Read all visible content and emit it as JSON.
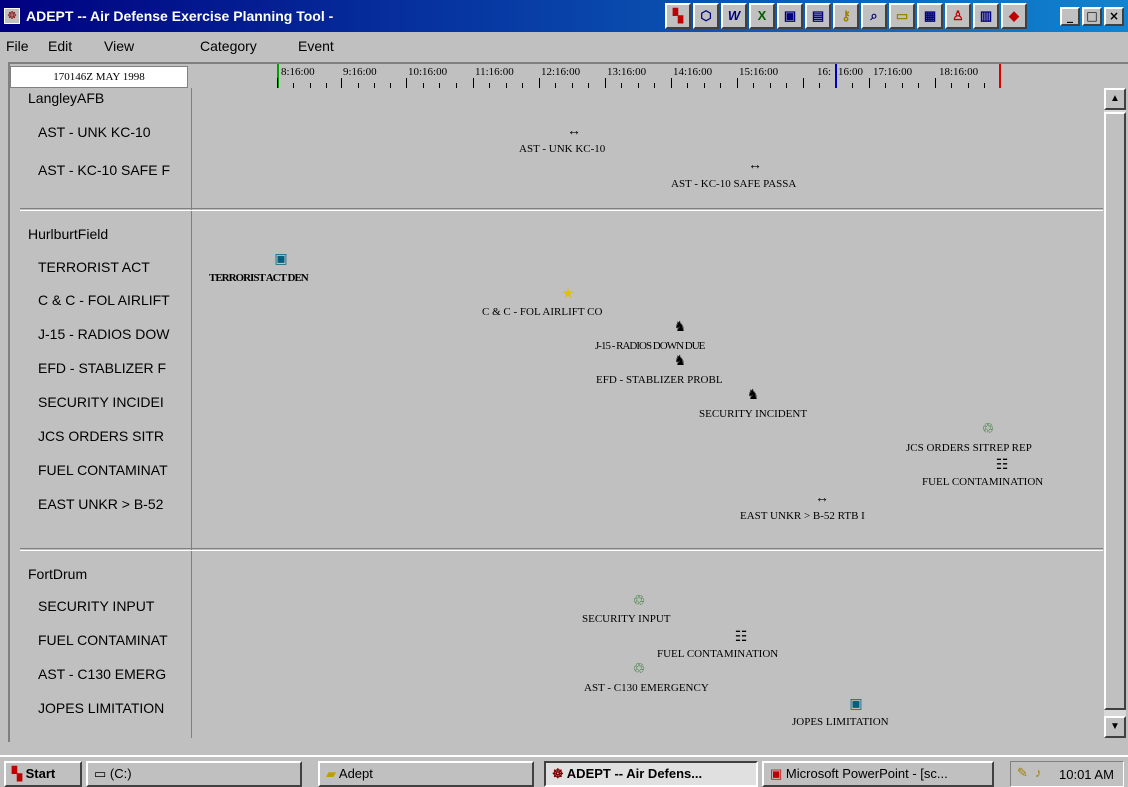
{
  "window": {
    "title": "ADEPT -- Air Defense Exercise Planning Tool -",
    "controls": {
      "minimize": "_",
      "maximize": "□",
      "close": "×"
    }
  },
  "toolbar_icons": [
    "palette-icon",
    "cube-icon",
    "word-icon",
    "excel-icon",
    "presentation-icon",
    "chart-icon",
    "key-icon",
    "magnifier-icon",
    "folder-icon",
    "terminal-icon",
    "people-icon",
    "monitor-icon",
    "diamond-icon"
  ],
  "menu": [
    "File",
    "Edit",
    "View",
    "Category",
    "Event"
  ],
  "timeline": {
    "date": "170146Z MAY 1998",
    "ticks": [
      "8:16:00",
      "9:16:00",
      "10:16:00",
      "11:16:00",
      "12:16:00",
      "13:16:00",
      "14:16:00",
      "15:16:00",
      "16:",
      "16:00",
      "17:16:00",
      "18:16:00"
    ],
    "marker_colors": {
      "start": "#00a000",
      "current": "#0000c0",
      "end": "#e00000"
    }
  },
  "groups": [
    {
      "name": "LangleyAFB",
      "rows": [
        {
          "label": "AST - UNK KC-10",
          "event": "AST - UNK KC-10",
          "icon": "arrow-double-icon"
        },
        {
          "label": "AST - KC-10 SAFE F",
          "event": "AST - KC-10 SAFE PASSA",
          "icon": "arrow-double-icon"
        }
      ]
    },
    {
      "name": "HurlburtField",
      "rows": [
        {
          "label": "TERRORIST ACT",
          "event": "TERRORIST ACT DEN",
          "icon": "computer-icon"
        },
        {
          "label": "C & C - FOL AIRLIFT",
          "event": "C & C - FOL AIRLIFT CO",
          "icon": "star-icon"
        },
        {
          "label": "J-15 - RADIOS DOW",
          "event": "J-15 - RADIOS DOWN DUE",
          "icon": "knight-icon"
        },
        {
          "label": "EFD - STABLIZER F",
          "event": "EFD - STABLIZER PROBL",
          "icon": "knight-icon"
        },
        {
          "label": "SECURITY INCIDEI",
          "event": "SECURITY INCIDENT",
          "icon": "knight-icon"
        },
        {
          "label": "JCS ORDERS SITR",
          "event": "JCS ORDERS SITREP REP",
          "icon": "network-icon"
        },
        {
          "label": "FUEL CONTAMINAT",
          "event": "FUEL CONTAMINATION",
          "icon": "hierarchy-icon"
        },
        {
          "label": "EAST UNKR > B-52",
          "event": "EAST UNKR > B-52 RTB I",
          "icon": "arrow-double-icon"
        }
      ]
    },
    {
      "name": "FortDrum",
      "rows": [
        {
          "label": "SECURITY INPUT",
          "event": "SECURITY INPUT",
          "icon": "network-icon"
        },
        {
          "label": "FUEL CONTAMINAT",
          "event": "FUEL CONTAMINATION",
          "icon": "hierarchy-icon"
        },
        {
          "label": "AST - C130 EMERG",
          "event": "AST - C130 EMERGENCY",
          "icon": "network-icon"
        },
        {
          "label": "JOPES LIMITATION",
          "event": "JOPES LIMITATION",
          "icon": "computer-icon"
        }
      ]
    }
  ],
  "taskbar": {
    "start": "Start",
    "items": [
      {
        "label": "(C:)",
        "icon": "drive-icon"
      },
      {
        "label": "Adept",
        "icon": "folder-icon"
      },
      {
        "label": "ADEPT -- Air Defens...",
        "icon": "adept-icon",
        "active": true
      },
      {
        "label": "Microsoft PowerPoint - [sc...",
        "icon": "powerpoint-icon"
      }
    ],
    "clock": "10:01 AM"
  }
}
